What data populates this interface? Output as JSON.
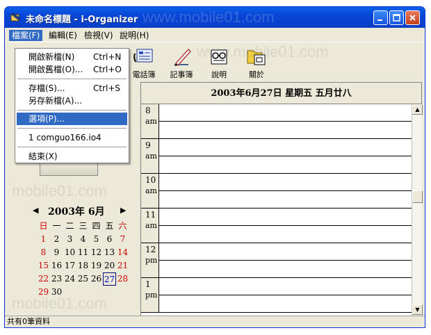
{
  "window": {
    "title": "未命名標題 - i-Organizer"
  },
  "watermark": "www.mobile01.com",
  "watermark_short": "mobile01.com",
  "menubar": [
    {
      "label": "檔案(F)"
    },
    {
      "label": "編輯(E)"
    },
    {
      "label": "檢視(V)"
    },
    {
      "label": "說明(H)"
    }
  ],
  "toolbar": [
    {
      "label": "電話簿",
      "icon": "phonebook-icon"
    },
    {
      "label": "記事簿",
      "icon": "notebook-icon"
    },
    {
      "label": "說明",
      "icon": "help-icon"
    },
    {
      "label": "關於",
      "icon": "about-icon"
    }
  ],
  "file_menu": {
    "new": {
      "label": "開啟新檔(N)",
      "shortcut": "Ctrl+N"
    },
    "open": {
      "label": "開啟舊檔(O)...",
      "shortcut": "Ctrl+O"
    },
    "save": {
      "label": "存檔(S)...",
      "shortcut": "Ctrl+S"
    },
    "save_as": {
      "label": "另存新檔(A)..."
    },
    "options": {
      "label": "選項(P)..."
    },
    "recent": {
      "label": "1 comguo166.io4"
    },
    "exit": {
      "label": "結束(X)"
    }
  },
  "calendar": {
    "title": "2003年 6月",
    "prev": "◀",
    "next": "▶",
    "weekdays": [
      "日",
      "一",
      "二",
      "三",
      "四",
      "五",
      "六"
    ],
    "weeks": [
      [
        "1",
        "2",
        "3",
        "4",
        "5",
        "6",
        "7"
      ],
      [
        "8",
        "9",
        "10",
        "11",
        "12",
        "13",
        "14"
      ],
      [
        "15",
        "16",
        "17",
        "18",
        "19",
        "20",
        "21"
      ],
      [
        "22",
        "23",
        "24",
        "25",
        "26",
        "27",
        "28"
      ],
      [
        "29",
        "30",
        "",
        "",
        "",
        "",
        ""
      ]
    ],
    "selected": "27"
  },
  "day_view": {
    "title": "2003年6月27日  星期五 五月廿八",
    "hours": [
      {
        "num": "8",
        "ampm": "am"
      },
      {
        "num": "9",
        "ampm": "am"
      },
      {
        "num": "10",
        "ampm": "am"
      },
      {
        "num": "11",
        "ampm": "am"
      },
      {
        "num": "12",
        "ampm": "pm"
      },
      {
        "num": "1",
        "ampm": "pm"
      }
    ]
  },
  "status": {
    "text": "共有0筆資料"
  },
  "colors": {
    "highlight": "#316ac5",
    "sunday": "#cc0000",
    "saturday": "#cc0000",
    "titlebar": "#0846d6"
  }
}
